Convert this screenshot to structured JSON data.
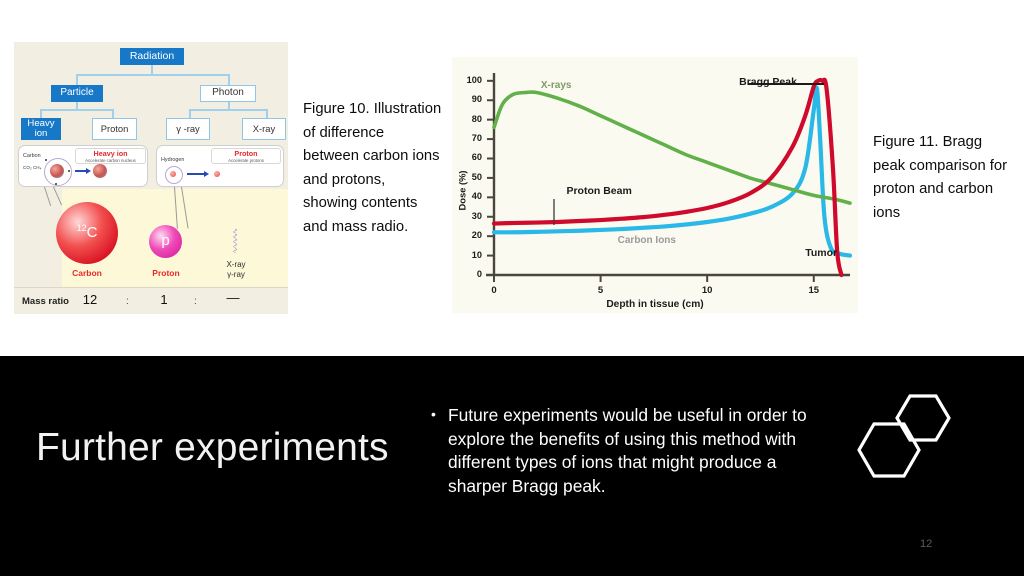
{
  "slide": {
    "title": "Further experiments",
    "page_number": "12",
    "background_color": "#000000",
    "text_color": "#ffffff",
    "bullets": [
      "Future experiments would be useful in order to explore the benefits of using this method with different types of ions that might produce a sharper Bragg peak."
    ]
  },
  "figure10": {
    "caption": "Figure 10. Illustration of difference between carbon ions and protons, showing contents and mass radio.",
    "accent_color": "#1878c8",
    "tree": {
      "root": {
        "label": "Radiation",
        "style": "filled"
      },
      "level2": [
        {
          "label": "Particle",
          "style": "filled"
        },
        {
          "label": "Photon",
          "style": "hollow"
        }
      ],
      "level3": [
        {
          "label": "Heavy ion",
          "style": "filled"
        },
        {
          "label": "Proton",
          "style": "hollow"
        },
        {
          "label": "γ -ray",
          "style": "hollow"
        },
        {
          "label": "X-ray",
          "style": "hollow"
        }
      ]
    },
    "detail_cards": [
      {
        "source_label": "Carbon",
        "source_sub": "CO₂ CH₄",
        "title": "Heavy ion",
        "subtitle": "Accelerate carbon nucleus"
      },
      {
        "source_label": "Hydrogen",
        "source_sub": "",
        "title": "Proton",
        "subtitle": "Accelerate protons"
      }
    ],
    "particles": [
      {
        "symbol": "12C",
        "symbol_sup": "12",
        "symbol_main": "C",
        "caption": "Carbon",
        "color": "#d81122"
      },
      {
        "symbol": "p",
        "symbol_sup": "",
        "symbol_main": "p",
        "caption": "Proton",
        "color": "#d4129a"
      }
    ],
    "photon_caption_line1": "X-ray",
    "photon_caption_line2": "γ-ray",
    "mass_ratio": {
      "label": "Mass ratio",
      "carbon": "12",
      "separator1": ":",
      "proton": "1",
      "separator2": ":",
      "photon": "—"
    }
  },
  "figure11": {
    "caption": "Figure 11. Bragg peak comparison for proton and carbon ions"
  },
  "chart_data": {
    "type": "line",
    "title": "",
    "xlabel": "Depth in tissue (cm)",
    "ylabel": "Dose (%)",
    "xlim": [
      0,
      16.7
    ],
    "ylim": [
      0,
      103
    ],
    "xticks": [
      "0",
      "5",
      "10",
      "15"
    ],
    "xtick_values": [
      0,
      5,
      10,
      15
    ],
    "yticks": [
      "0",
      "10",
      "20",
      "30",
      "40",
      "50",
      "60",
      "70",
      "80",
      "90",
      "100"
    ],
    "ytick_values": [
      0,
      10,
      20,
      30,
      40,
      50,
      60,
      70,
      80,
      90,
      100
    ],
    "grid": false,
    "legend": "inline-annotations",
    "background": "#fbfaf0",
    "annotations": [
      {
        "text": "X-rays",
        "color": "#7f9a6b",
        "x": 2.2,
        "y": 97
      },
      {
        "text": "Proton Beam",
        "color": "#1b1b1b",
        "x": 3.4,
        "y": 43
      },
      {
        "text": "Carbon Ions",
        "color": "#9a9a9a",
        "x": 5.8,
        "y": 17
      },
      {
        "text": "Bragg Peak",
        "color": "#1b1b1b",
        "x": 11.5,
        "y": 99
      },
      {
        "text": "Tumor",
        "color": "#1b1b1b",
        "x": 14.6,
        "y": 11
      }
    ],
    "series": [
      {
        "name": "X-rays",
        "color": "#62b04a",
        "x": [
          0,
          0.4,
          0.9,
          1.5,
          2,
          3,
          4,
          5,
          6,
          7,
          8,
          9,
          10,
          11,
          12,
          13,
          14,
          15,
          16,
          16.7
        ],
        "values": [
          76,
          88,
          93,
          94,
          94,
          91,
          87,
          82,
          77,
          72,
          67,
          62,
          58,
          54,
          50,
          47,
          44,
          41,
          39,
          37
        ]
      },
      {
        "name": "Proton Beam",
        "color": "#cf0a2c",
        "x": [
          0,
          1,
          2,
          3,
          4,
          5,
          6,
          7,
          8,
          9,
          10,
          11,
          12,
          13,
          14,
          14.6,
          15,
          15.2,
          15.4,
          15.6,
          15.9,
          16.1,
          16.3
        ],
        "values": [
          26.5,
          26.8,
          27,
          27.3,
          27.8,
          28.3,
          29,
          29.8,
          31,
          32.5,
          34.5,
          37.5,
          42,
          50,
          66,
          82,
          97,
          100,
          100,
          96,
          55,
          12,
          0
        ]
      },
      {
        "name": "Carbon Ions",
        "color": "#29b8e8",
        "x": [
          0,
          1,
          2,
          3,
          4,
          5,
          6,
          7,
          8,
          9,
          10,
          11,
          12,
          13,
          14,
          14.6,
          15,
          15.15,
          15.3,
          15.5,
          15.8,
          16.2,
          16.7
        ],
        "values": [
          22,
          22,
          22.2,
          22.5,
          22.8,
          23.2,
          23.7,
          24.3,
          25,
          26,
          27.3,
          29,
          31.5,
          35,
          42,
          55,
          85,
          96,
          70,
          30,
          14,
          11,
          10
        ]
      }
    ]
  }
}
